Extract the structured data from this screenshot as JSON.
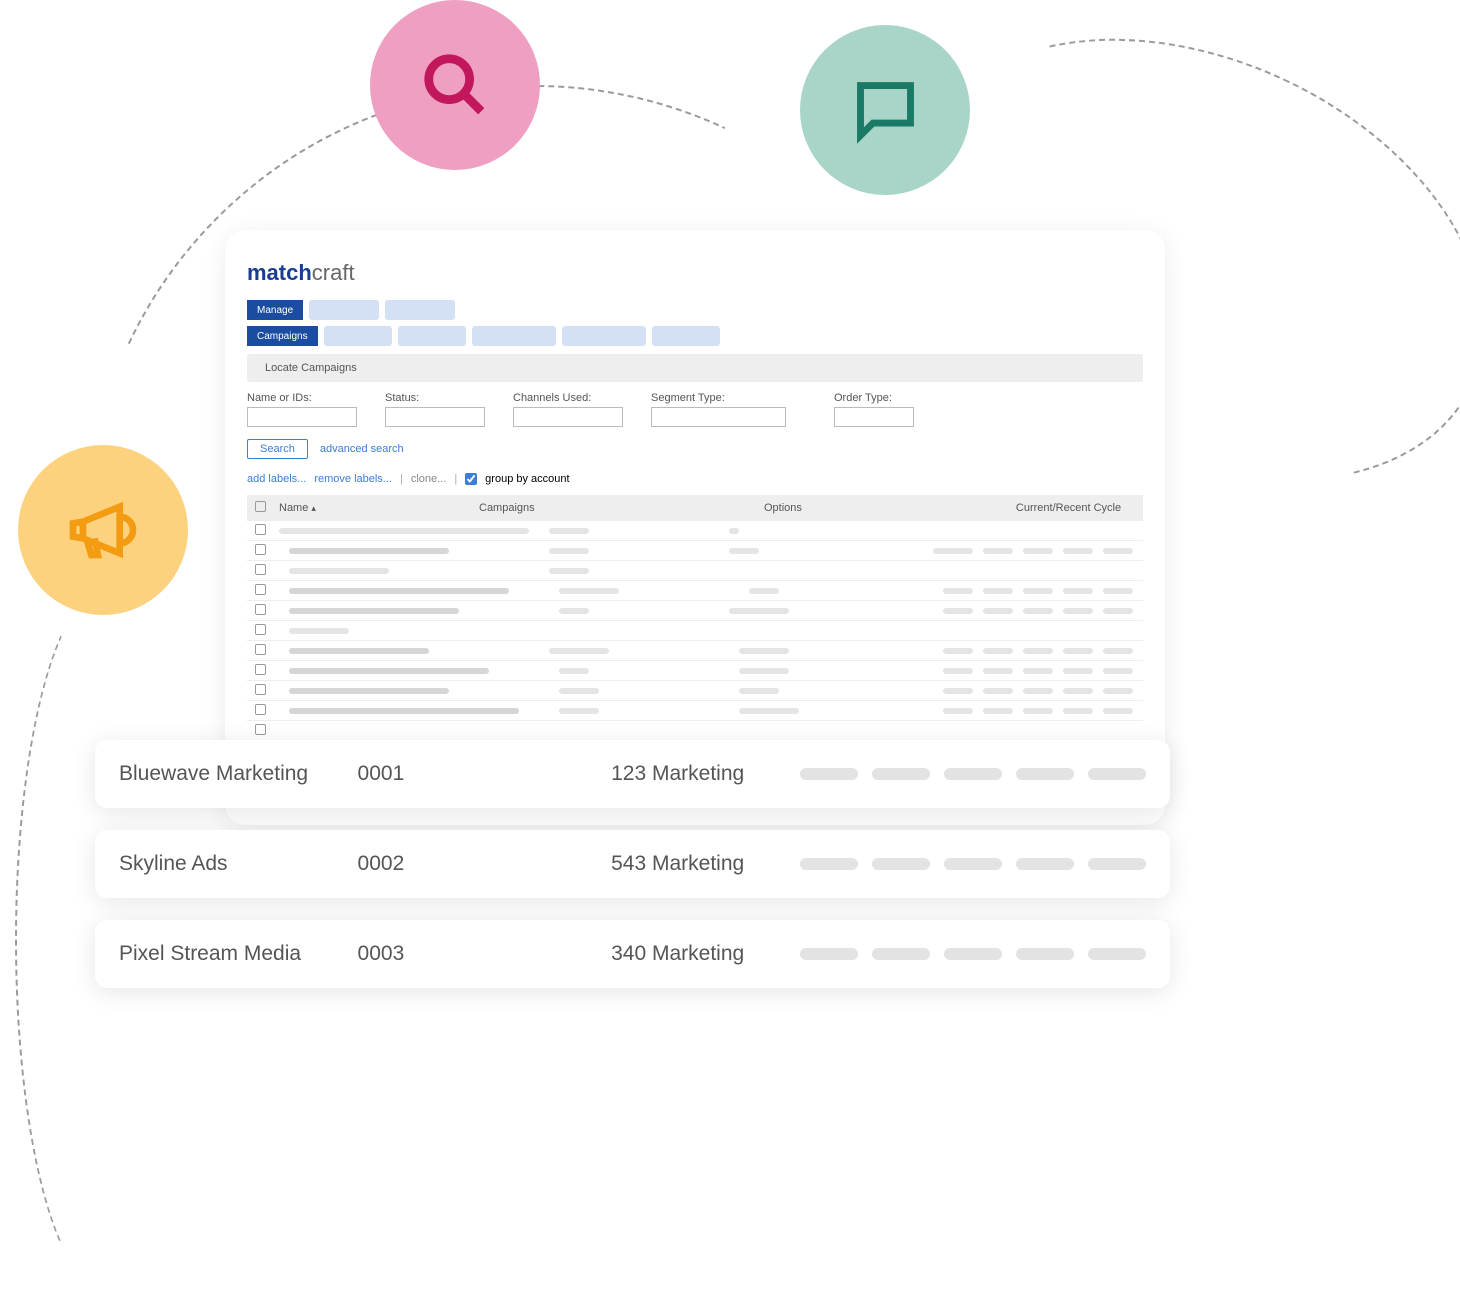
{
  "brand": {
    "part1": "match",
    "part2": "craft"
  },
  "nav": {
    "row1": {
      "active": "Manage"
    },
    "row2": {
      "active": "Campaigns"
    }
  },
  "section_title": "Locate Campaigns",
  "filters": {
    "name_label": "Name or IDs:",
    "status_label": "Status:",
    "channels_label": "Channels Used:",
    "segment_label": "Segment Type:",
    "order_label": "Order Type:"
  },
  "search_button": "Search",
  "advanced_link": "advanced search",
  "actions": {
    "add_labels": "add labels...",
    "remove_labels": "remove labels...",
    "clone": "clone...",
    "group_by_account": "group by account"
  },
  "columns": {
    "name": "Name",
    "campaigns": "Campaigns",
    "options": "Options",
    "cycle": "Current/Recent Cycle"
  },
  "cards": [
    {
      "name": "Bluewave Marketing",
      "id": "0001",
      "campaign": "123 Marketing"
    },
    {
      "name": "Skyline Ads",
      "id": "0002",
      "campaign": "543 Marketing"
    },
    {
      "name": "Pixel Stream Media",
      "id": "0003",
      "campaign": "340 Marketing"
    }
  ]
}
